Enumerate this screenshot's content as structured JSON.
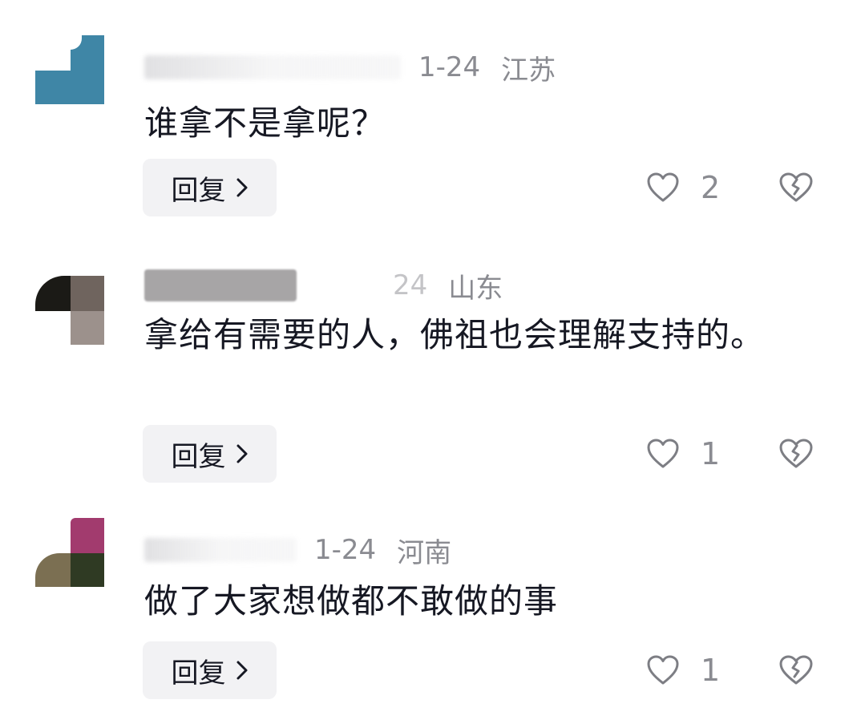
{
  "comments": [
    {
      "date": "1-24",
      "location": "江苏",
      "text": "谁拿不是拿呢？",
      "reply_label": "回复",
      "likes": "2",
      "avatar_colors": [
        "#3f86a6",
        "#ffffff"
      ]
    },
    {
      "date": "24",
      "location": "山东",
      "text": "拿给有需要的人，佛祖也会理解支持的。",
      "reply_label": "回复",
      "likes": "1",
      "avatar_colors": [
        "#1b1a16",
        "#6f645e",
        "#9c918c"
      ]
    },
    {
      "date": "1-24",
      "location": "河南",
      "text": "做了大家想做都不敢做的事",
      "reply_label": "回复",
      "likes": "1",
      "avatar_colors": [
        "#a23b6e",
        "#7b6f52",
        "#2f3a23"
      ]
    }
  ],
  "icons": {
    "chevron": "chevron-right-icon",
    "like": "heart-outline-icon",
    "dislike": "broken-heart-icon"
  },
  "colors": {
    "text_primary": "#161823",
    "text_secondary": "#8a8b91",
    "button_bg": "#f2f2f4",
    "icon_stroke": "#7d7e84"
  }
}
